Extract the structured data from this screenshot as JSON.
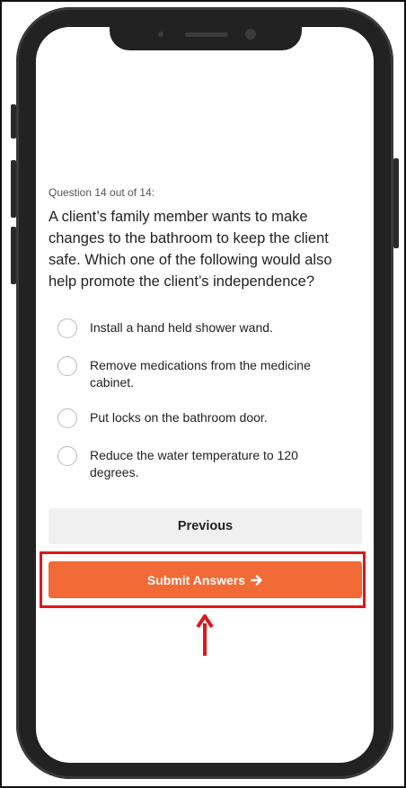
{
  "quiz": {
    "counter": "Question 14 out of 14:",
    "question": "A client’s family member wants to make changes to the bathroom to keep the client safe. Which one of the following would also help promote the client’s independence?",
    "options": [
      {
        "label": "Install a hand held shower wand."
      },
      {
        "label": "Remove medications from the medicine cabinet."
      },
      {
        "label": "Put locks on the bathroom door."
      },
      {
        "label": "Reduce the water temperature to 120 degrees."
      }
    ],
    "previous_label": "Previous",
    "submit_label": "Submit Answers",
    "submit_icon": "arrow-right-icon"
  },
  "colors": {
    "accent": "#f26a35",
    "highlight": "#e0161b",
    "phone": "#222222"
  }
}
